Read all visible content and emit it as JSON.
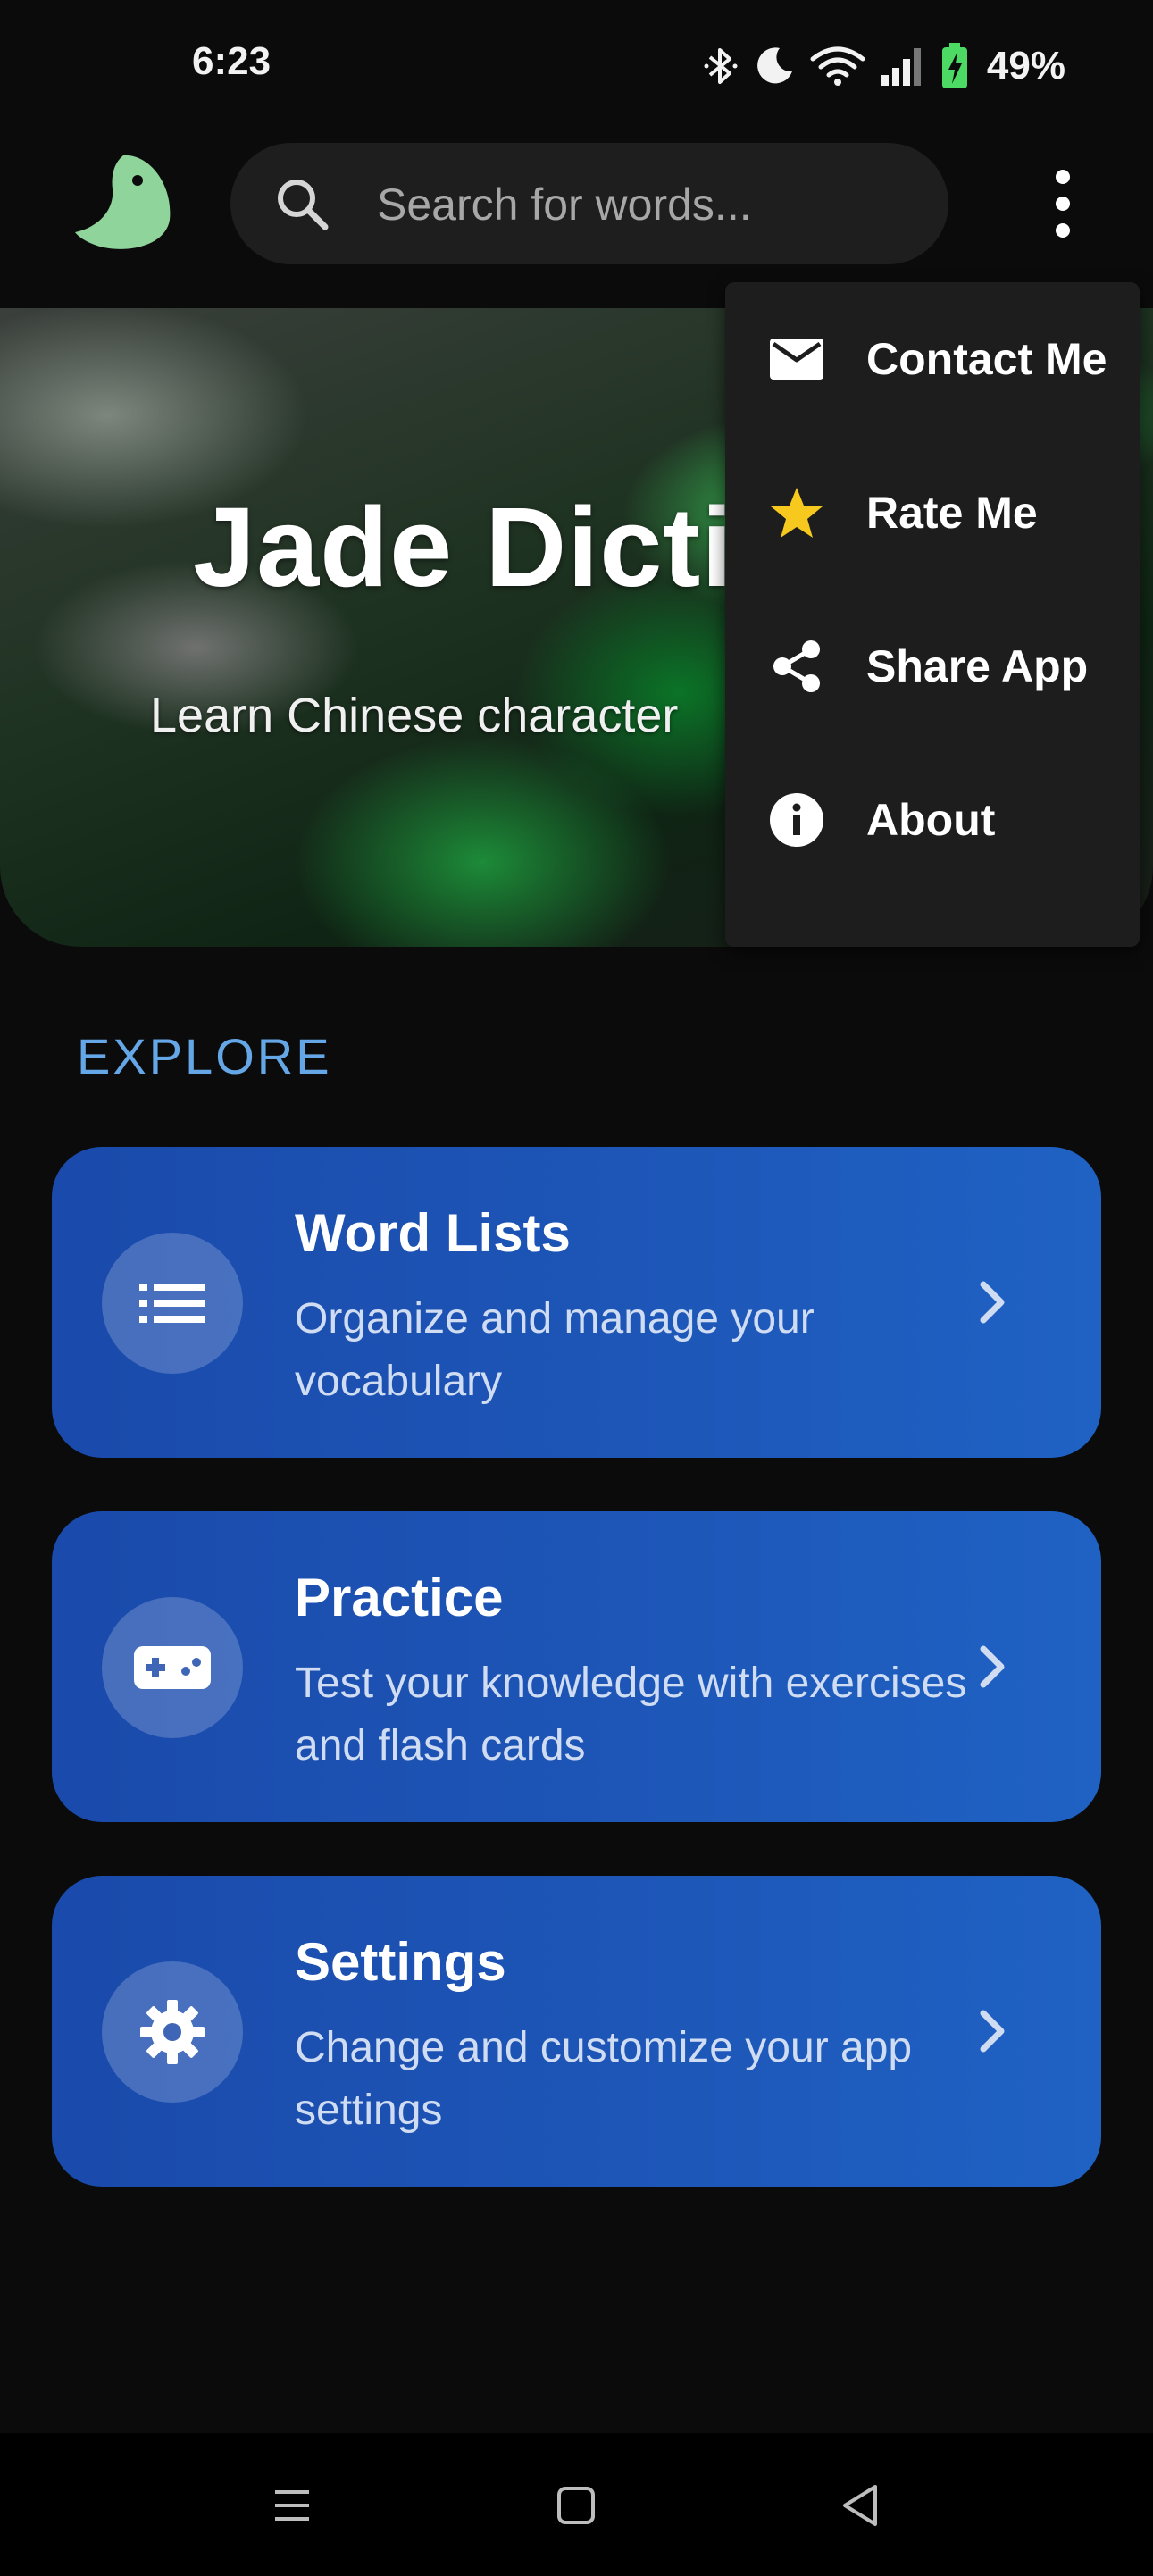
{
  "status_bar": {
    "time": "6:23",
    "battery_percent": "49%",
    "icons": [
      "bluetooth-icon",
      "do-not-disturb-moon-icon",
      "wifi-icon",
      "signal-icon",
      "battery-charging-icon"
    ]
  },
  "app_bar": {
    "logo_icon": "jade-bird-logo",
    "search_placeholder": "Search for words...",
    "search_value": "",
    "overflow_icon": "more-vert-icon"
  },
  "hero": {
    "title": "Jade Dictio",
    "subtitle": "Learn Chinese character"
  },
  "overflow_menu": {
    "items": [
      {
        "label": "Contact Me",
        "icon": "email-icon"
      },
      {
        "label": "Rate Me",
        "icon": "star-icon"
      },
      {
        "label": "Share App",
        "icon": "share-icon"
      },
      {
        "label": "About",
        "icon": "info-icon"
      }
    ]
  },
  "explore": {
    "heading": "EXPLORE",
    "cards": [
      {
        "title": "Word Lists",
        "description": "Organize and manage your vocabulary",
        "icon": "list-icon"
      },
      {
        "title": "Practice",
        "description": "Test your knowledge with exercises and flash cards",
        "icon": "gamepad-icon"
      },
      {
        "title": "Settings",
        "description": "Change and customize your app settings",
        "icon": "gear-icon"
      }
    ]
  },
  "nav_bar": {
    "buttons": [
      "menu-icon",
      "home-square-icon",
      "back-triangle-icon"
    ]
  },
  "colors": {
    "background": "#0b0b0b",
    "accent_blue": "#1d56b7",
    "explore_heading": "#64a6e6",
    "logo_green": "#8fd49a",
    "star_yellow": "#f7c81e",
    "battery_green": "#4cd964"
  }
}
